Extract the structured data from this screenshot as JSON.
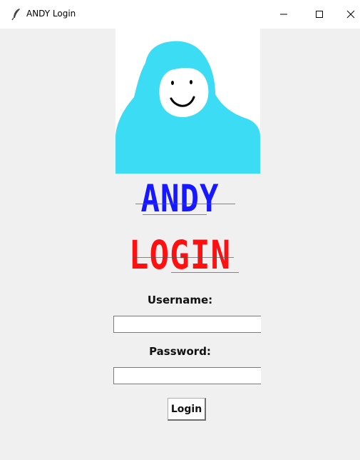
{
  "window": {
    "title": "ANDY Login",
    "controls": {
      "minimize_icon": "minimize-icon",
      "maximize_icon": "maximize-icon",
      "close_icon": "close-icon"
    }
  },
  "avatar": {
    "icon": "gorilla-avatar",
    "colors": {
      "fur": "#3cdcf4",
      "face": "#ffffff",
      "background": "#ffffff"
    }
  },
  "logo": {
    "line1": "ANDY",
    "line2": "LOGIN",
    "colors": {
      "line1": "#1818ff",
      "line2": "#ff1010"
    }
  },
  "form": {
    "username_label": "Username:",
    "username_value": "",
    "password_label": "Password:",
    "password_value": "",
    "login_label": "Login"
  }
}
